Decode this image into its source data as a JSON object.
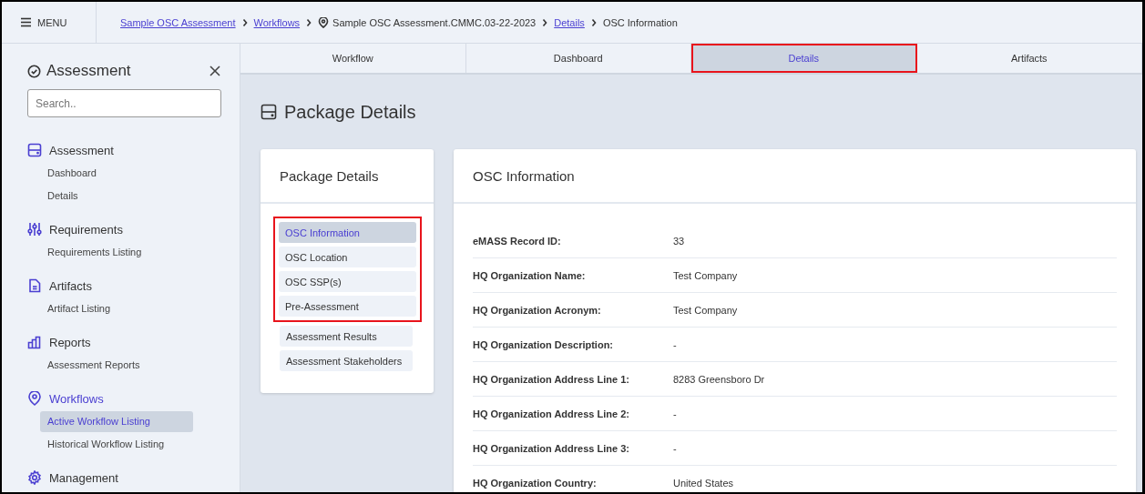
{
  "topbar": {
    "menu_label": "MENU",
    "breadcrumbs": [
      {
        "label": "Sample OSC Assessment",
        "kind": "link"
      },
      {
        "label": "Workflows",
        "kind": "link"
      },
      {
        "label": "Sample OSC Assessment.CMMC.03-22-2023",
        "kind": "pin"
      },
      {
        "label": "Details",
        "kind": "link"
      },
      {
        "label": "OSC Information",
        "kind": "current"
      }
    ]
  },
  "sidebar": {
    "title": "Assessment",
    "search": {
      "placeholder": "Search.."
    },
    "sections": [
      {
        "title": "Assessment",
        "active": false,
        "items": [
          {
            "label": "Dashboard",
            "selected": false
          },
          {
            "label": "Details",
            "selected": false
          }
        ]
      },
      {
        "title": "Requirements",
        "active": false,
        "items": [
          {
            "label": "Requirements Listing",
            "selected": false
          }
        ]
      },
      {
        "title": "Artifacts",
        "active": false,
        "items": [
          {
            "label": "Artifact Listing",
            "selected": false
          }
        ]
      },
      {
        "title": "Reports",
        "active": false,
        "items": [
          {
            "label": "Assessment Reports",
            "selected": false
          }
        ]
      },
      {
        "title": "Workflows",
        "active": true,
        "items": [
          {
            "label": "Active Workflow Listing",
            "selected": true
          },
          {
            "label": "Historical Workflow Listing",
            "selected": false
          }
        ]
      },
      {
        "title": "Management",
        "active": false
      }
    ]
  },
  "tabs": [
    {
      "label": "Workflow",
      "selected": false,
      "highlighted": false
    },
    {
      "label": "Dashboard",
      "selected": false,
      "highlighted": false
    },
    {
      "label": "Details",
      "selected": true,
      "highlighted": true
    },
    {
      "label": "Artifacts",
      "selected": false,
      "highlighted": false
    }
  ],
  "page_title": "Package Details",
  "package_nav": {
    "title": "Package Details",
    "highlighted_items": [
      {
        "label": "OSC Information",
        "selected": true
      },
      {
        "label": "OSC Location",
        "selected": false
      },
      {
        "label": "OSC SSP(s)",
        "selected": false
      },
      {
        "label": "Pre-Assessment",
        "selected": false
      }
    ],
    "items": [
      {
        "label": "Assessment Results",
        "selected": false
      },
      {
        "label": "Assessment Stakeholders",
        "selected": false
      }
    ]
  },
  "details": {
    "title": "OSC Information",
    "rows": [
      {
        "label": "eMASS Record ID:",
        "value": "33"
      },
      {
        "label": "HQ Organization Name:",
        "value": "Test Company"
      },
      {
        "label": "HQ Organization Acronym:",
        "value": "Test Company"
      },
      {
        "label": "HQ Organization Description:",
        "value": "-"
      },
      {
        "label": "HQ Organization Address Line 1:",
        "value": "8283 Greensboro Dr"
      },
      {
        "label": "HQ Organization Address Line 2:",
        "value": "-"
      },
      {
        "label": "HQ Organization Address Line 3:",
        "value": "-"
      },
      {
        "label": "HQ Organization Country:",
        "value": "United States"
      }
    ]
  }
}
